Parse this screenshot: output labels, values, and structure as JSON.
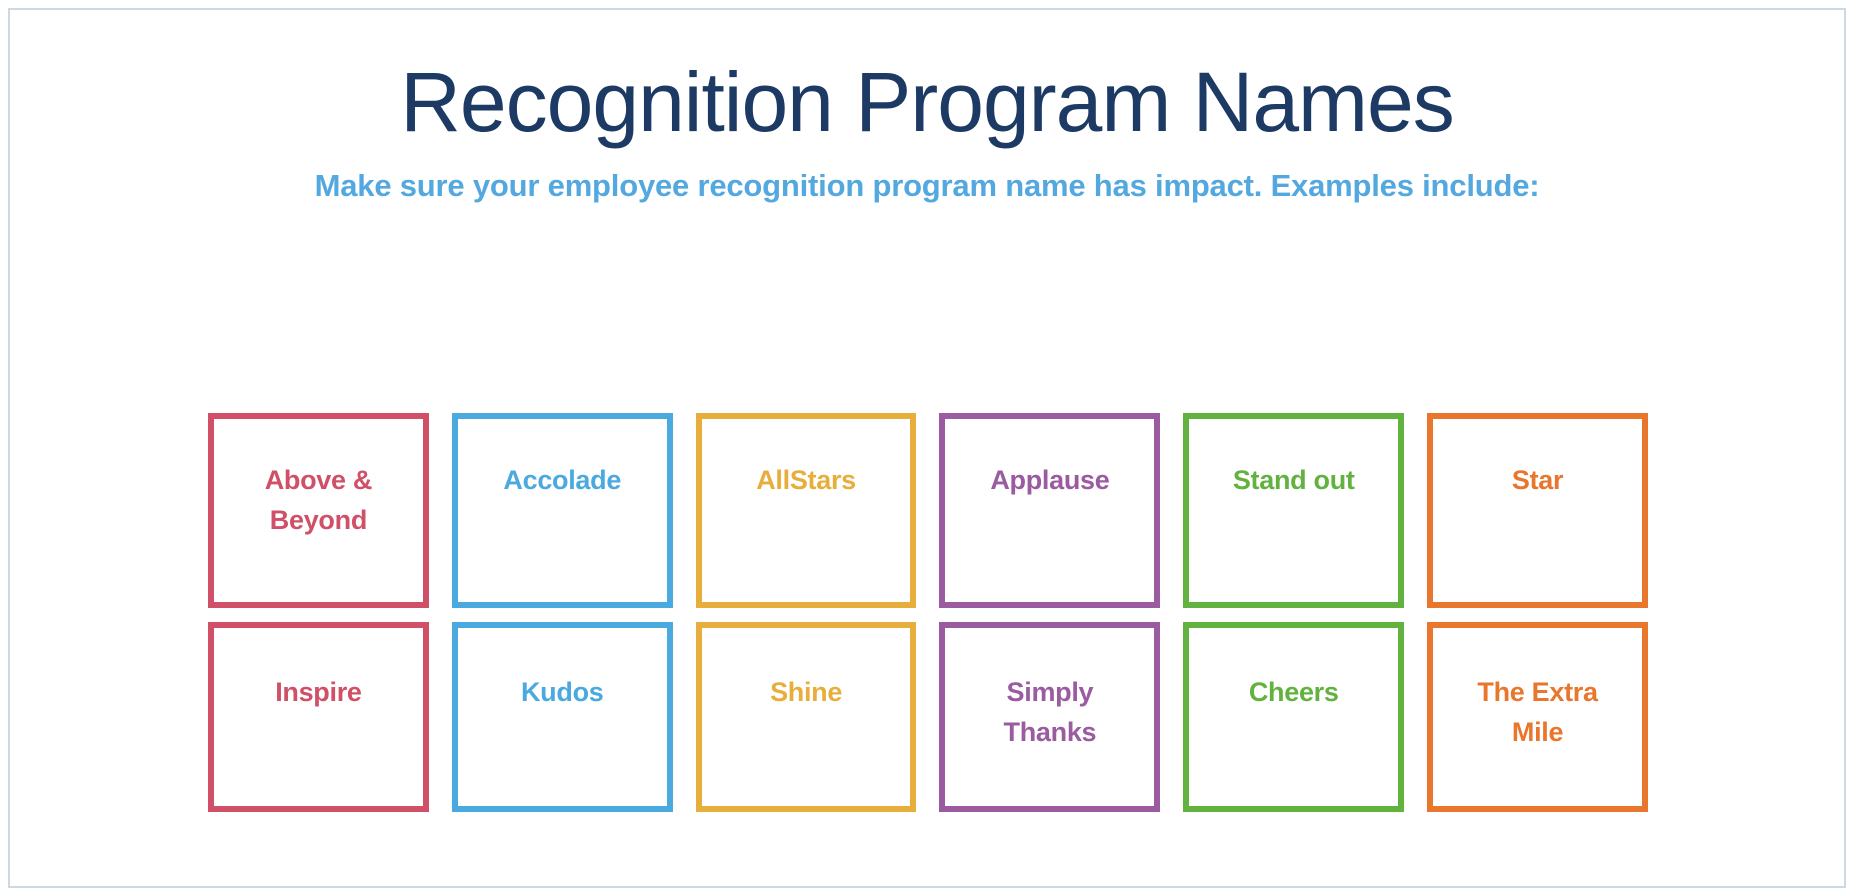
{
  "header": {
    "title": "Recognition Program Names",
    "subtitle": "Make sure your employee recognition program name has impact. Examples include:",
    "title_color": "#1c3a63",
    "subtitle_color": "#53a8e0"
  },
  "slide": {
    "background_color": "#ffffff",
    "border_color": "#ccd9e3"
  },
  "grid": {
    "rows": [
      {
        "cards": [
          {
            "label": "Above &\nBeyond",
            "color": "#cf5067"
          },
          {
            "label": "Accolade",
            "color": "#4aaae0"
          },
          {
            "label": "AllStars",
            "color": "#e8ae3c"
          },
          {
            "label": "Applause",
            "color": "#9a5ba0"
          },
          {
            "label": "Stand out",
            "color": "#62b23f"
          },
          {
            "label": "Star",
            "color": "#e8762c"
          }
        ]
      },
      {
        "cards": [
          {
            "label": "Inspire",
            "color": "#cf5067"
          },
          {
            "label": "Kudos",
            "color": "#4aaae0"
          },
          {
            "label": "Shine",
            "color": "#e8ae3c"
          },
          {
            "label": "Simply\nThanks",
            "color": "#9a5ba0"
          },
          {
            "label": "Cheers",
            "color": "#62b23f"
          },
          {
            "label": "The Extra\nMile",
            "color": "#e8762c"
          }
        ]
      }
    ]
  }
}
